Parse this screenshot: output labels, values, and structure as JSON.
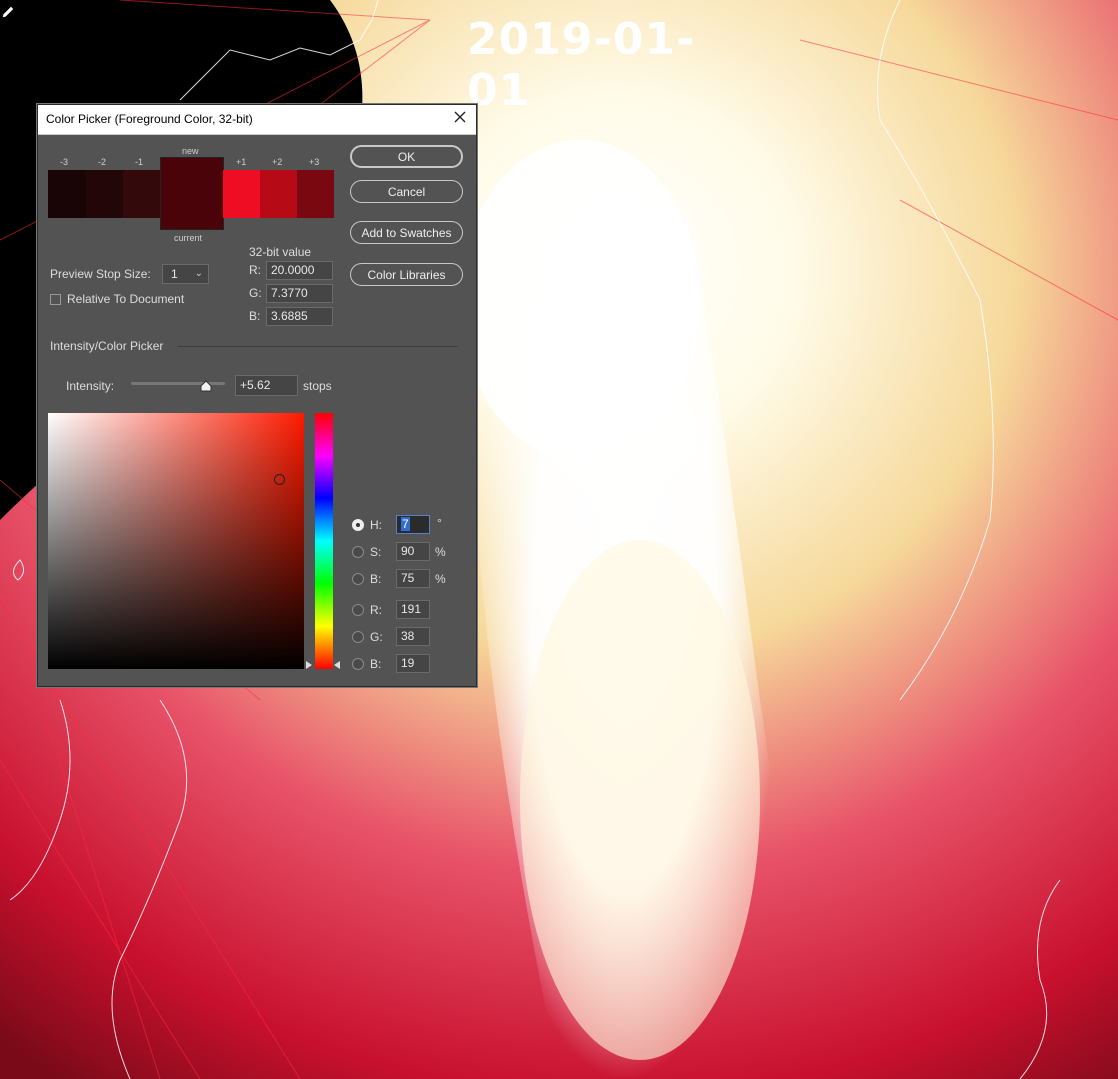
{
  "background": {
    "date_label": "2019-01-01"
  },
  "dialog": {
    "title": "Color Picker (Foreground Color, 32-bit)",
    "swatch_labels": {
      "minus3": "-3",
      "minus2": "-2",
      "minus1": "-1",
      "new": "new",
      "plus1": "+1",
      "plus2": "+2",
      "plus3": "+3",
      "current": "current"
    },
    "swatch_colors": {
      "minus3": "#1a0506",
      "minus2": "#230708",
      "minus1": "#33090b",
      "new": "#4a0308",
      "current": "#4a0308",
      "plus1": "#ee0d22",
      "plus2": "#b70a17",
      "plus3": "#790810"
    },
    "buttons": {
      "ok": "OK",
      "cancel": "Cancel",
      "add_to_swatches": "Add to Swatches",
      "color_libraries": "Color Libraries"
    },
    "value32": {
      "heading": "32-bit value",
      "r_label": "R:",
      "r": "20.0000",
      "g_label": "G:",
      "g": "7.3770",
      "b_label": "B:",
      "b": "3.6885"
    },
    "preview_stop_size": {
      "label": "Preview Stop Size:",
      "value": "1"
    },
    "relative_to_document": {
      "label": "Relative To Document",
      "checked": false
    },
    "section_heading": "Intensity/Color Picker",
    "intensity": {
      "label": "Intensity:",
      "value": "+5.62",
      "unit": "stops",
      "level": 0.8
    },
    "hsb": {
      "h": {
        "label": "H:",
        "value": "7",
        "unit": "°",
        "selected": true
      },
      "s": {
        "label": "S:",
        "value": "90",
        "unit": "%"
      },
      "b": {
        "label": "B:",
        "value": "75",
        "unit": "%"
      }
    },
    "rgb": {
      "r": {
        "label": "R:",
        "value": "191"
      },
      "g": {
        "label": "G:",
        "value": "38"
      },
      "b": {
        "label": "B:",
        "value": "19"
      }
    }
  }
}
